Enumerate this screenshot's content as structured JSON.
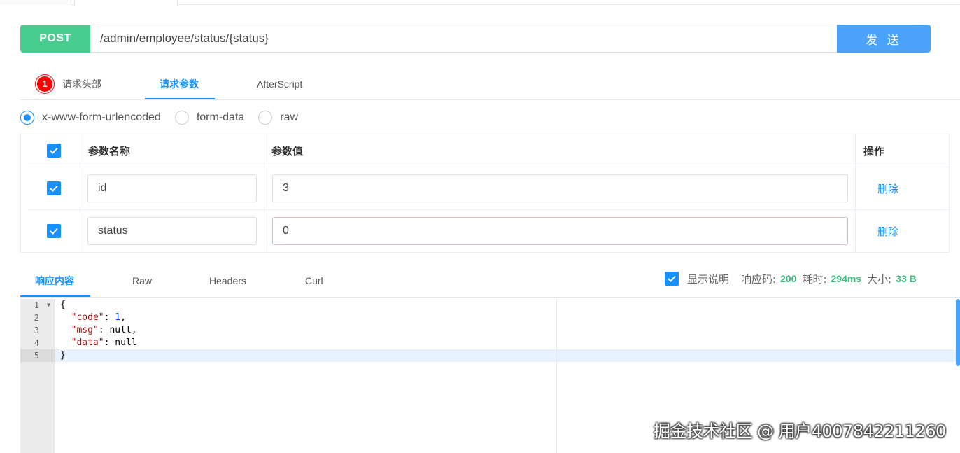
{
  "url_bar": {
    "method": "POST",
    "url": "/admin/employee/status/{status}",
    "send_label": "发 送"
  },
  "request_tabs": {
    "headers_badge": "1",
    "headers_label": "请求头部",
    "params_label": "请求参数",
    "afterscript_label": "AfterScript",
    "active": "请求参数"
  },
  "body_types": {
    "options": [
      "x-www-form-urlencoded",
      "form-data",
      "raw"
    ],
    "selected": "x-www-form-urlencoded"
  },
  "params_table": {
    "header_name": "参数名称",
    "header_value": "参数值",
    "header_action": "操作",
    "rows": [
      {
        "checked": true,
        "name": "id",
        "value": "3",
        "action": "删除"
      },
      {
        "checked": true,
        "name": "status",
        "value": "0",
        "action": "删除"
      }
    ]
  },
  "response_tabs": {
    "tabs": [
      "响应内容",
      "Raw",
      "Headers",
      "Curl"
    ],
    "active": "响应内容",
    "show_desc_label": "显示说明",
    "show_desc_checked": true,
    "status_label": "响应码:",
    "status_value": "200",
    "time_label": "耗时:",
    "time_value": "294ms",
    "size_label": "大小:",
    "size_value": "33 B"
  },
  "response_body": {
    "line_numbers": [
      "1",
      "2",
      "3",
      "4",
      "5"
    ],
    "lines": [
      "{",
      "  \"code\": 1,",
      "  \"msg\": null,",
      "  \"data\": null",
      "}"
    ]
  },
  "watermark": "掘金技术社区 @ 用户4007842211260",
  "colors": {
    "method_post": "#49cc90",
    "send_button": "#4aa3f8",
    "accent": "#1890ff",
    "badge": "#ff0000",
    "meta_value": "#3dbd7d"
  }
}
